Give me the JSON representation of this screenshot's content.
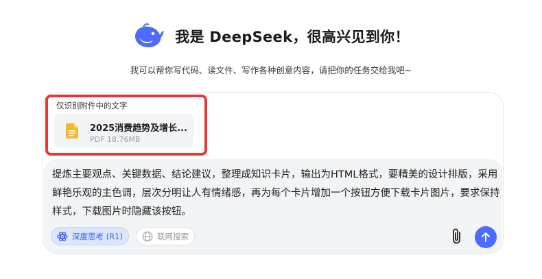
{
  "header": {
    "title": "我是 DeepSeek，很高兴见到你！",
    "logo_icon": "deepseek-whale-icon"
  },
  "subtitle": "我可以帮你写代码、读文件、写作各种创意内容，请把你的任务交给我吧~",
  "attachment": {
    "label": "仅识别附件中的文字",
    "file_name": "2025消费趋势及增长...",
    "file_meta": "PDF 18.76MB",
    "file_icon": "document-icon",
    "highlight_color": "#e53935"
  },
  "input": {
    "value": "提炼主要观点、关键数据、结论建议，整理成知识卡片，输出为HTML格式，要精美的设计排版，采用鲜艳乐观的主色调，层次分明让人有情绪感，再为每个卡片增加一个按钮方便下载卡片图片，要求保持样式，下载图片时隐藏该按钮。"
  },
  "toolbar": {
    "deep_think_label": "深度思考 (R1)",
    "deep_think_icon": "atom-icon",
    "web_search_label": "联网搜索",
    "web_search_icon": "globe-icon",
    "attach_icon": "paperclip-icon",
    "send_icon": "arrow-up-icon"
  },
  "colors": {
    "accent": "#4d6bfe",
    "pill_active_bg": "#dbe6fd",
    "input_bg": "#f3f4f6"
  }
}
